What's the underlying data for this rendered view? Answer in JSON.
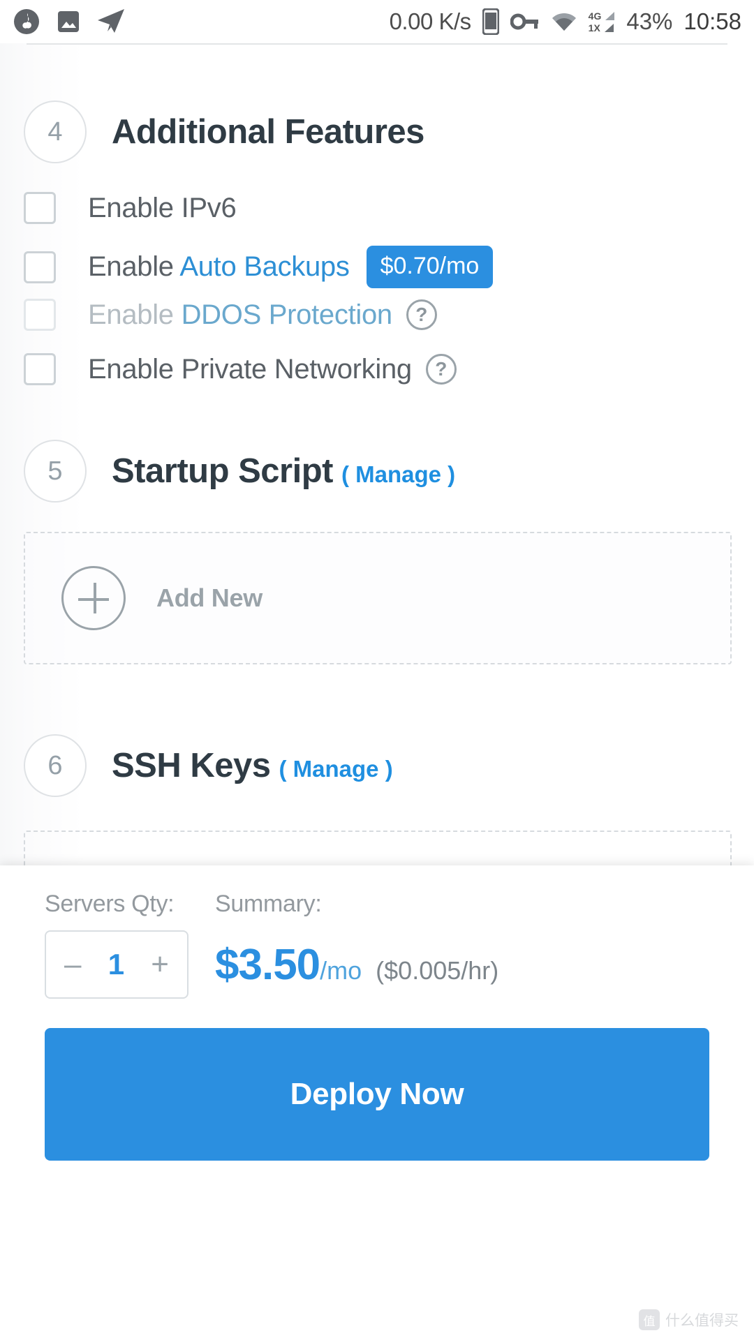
{
  "statusbar": {
    "icons": [
      "music-note-icon",
      "gallery-icon",
      "telegram-send-icon"
    ],
    "network_speed": "0.00 K/s",
    "right_icons": [
      "phone-icon",
      "vpn-key-icon",
      "wifi-icon"
    ],
    "signal_4g": "4G",
    "signal_1x": "1X",
    "battery": "43%",
    "time": "10:58"
  },
  "sections": {
    "additional_features": {
      "step": "4",
      "title": "Additional Features",
      "options": [
        {
          "prefix": "Enable ",
          "link": "",
          "suffix": "IPv6",
          "checked": false,
          "disabled": false,
          "help": false,
          "badge": ""
        },
        {
          "prefix": "Enable ",
          "link": "Auto Backups",
          "suffix": "",
          "checked": false,
          "disabled": false,
          "help": false,
          "badge": "$0.70/mo"
        },
        {
          "prefix": "Enable ",
          "link": "DDOS Protection",
          "suffix": "",
          "checked": false,
          "disabled": true,
          "help": true,
          "badge": ""
        },
        {
          "prefix": "Enable Private Networking",
          "link": "",
          "suffix": "",
          "checked": false,
          "disabled": false,
          "help": true,
          "badge": ""
        }
      ],
      "help_glyph": "?"
    },
    "startup_script": {
      "step": "5",
      "title": "Startup Script",
      "manage": "( Manage )",
      "add_new": "Add New",
      "plus_icon": "plus-circle-icon"
    },
    "ssh_keys": {
      "step": "6",
      "title": "SSH Keys",
      "manage": "( Manage )"
    }
  },
  "bottombar": {
    "qty_label": "Servers Qty:",
    "summary_label": "Summary:",
    "minus": "–",
    "quantity": "1",
    "plus": "+",
    "price_main": "$3.50",
    "price_unit": "/mo",
    "price_hourly": "($0.005/hr)",
    "deploy_label": "Deploy Now"
  },
  "watermark": {
    "badge": "值",
    "text": "什么值得买"
  },
  "colors": {
    "accent": "#2b8fe0",
    "link": "#2d8fd5",
    "title": "#2f3b44",
    "muted": "#93999e",
    "border": "#d9dee2"
  }
}
